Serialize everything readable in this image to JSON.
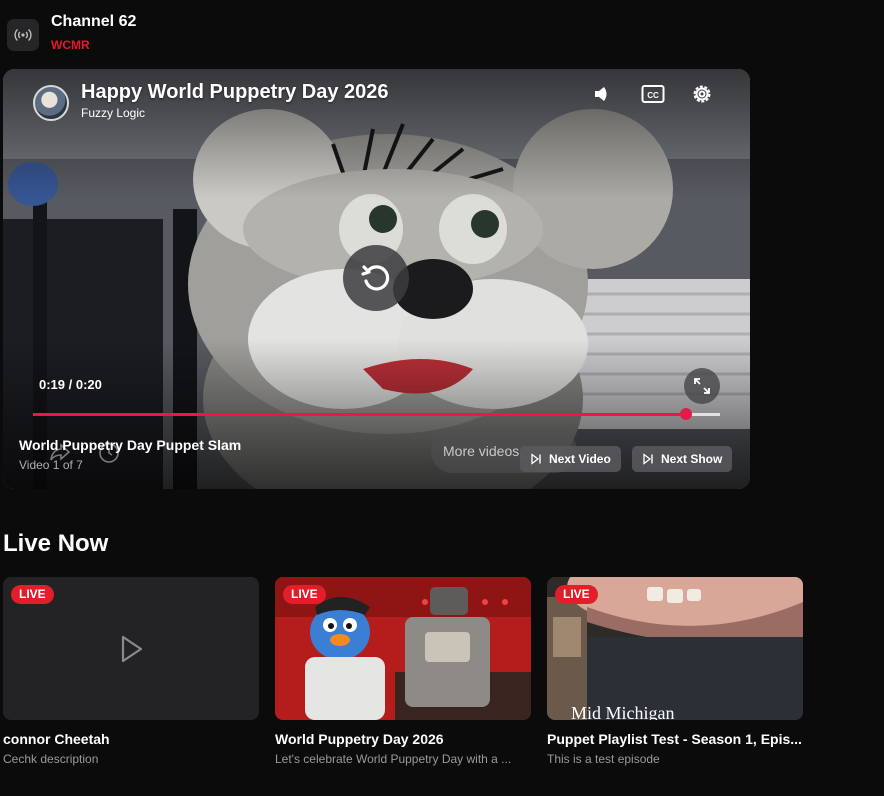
{
  "channel": {
    "name": "Channel 62",
    "callsign": "WCMR",
    "icon": "broadcast-icon"
  },
  "player": {
    "title": "Happy World Puppetry Day 2026",
    "creator": "Fuzzy Logic",
    "time": "0:19 / 0:20",
    "progress": 0.95,
    "playlist_title": "World Puppetry Day Puppet Slam",
    "playlist_position": "Video 1 of 7",
    "more_videos_label": "More videos",
    "next_video_label": "Next Video",
    "next_show_label": "Next Show",
    "accent_color": "#e8184a"
  },
  "live_now": {
    "heading": "Live Now",
    "badge": "LIVE",
    "cards": [
      {
        "title": "connor Cheetah",
        "description": "Cechk description"
      },
      {
        "title": "World Puppetry Day 2026",
        "description": "Let's celebrate World Puppetry Day with a ..."
      },
      {
        "title": "Puppet Playlist Test - Season 1, Epis...",
        "description": "This is a test episode",
        "watermark": "Mid Michigan"
      }
    ]
  }
}
